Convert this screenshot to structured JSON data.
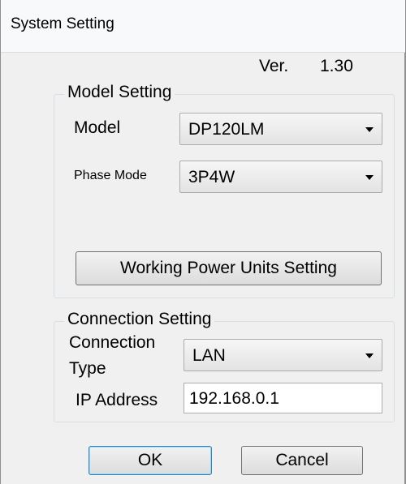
{
  "window": {
    "title": "System Setting"
  },
  "version": {
    "label": "Ver.",
    "value": "1.30"
  },
  "model_setting": {
    "group_title": "Model Setting",
    "model_label": "Model",
    "model_value": "DP120LM",
    "phase_mode_label": "Phase Mode",
    "phase_mode_value": "3P4W",
    "working_power_units_button": "Working Power Units Setting"
  },
  "connection_setting": {
    "group_title": "Connection Setting",
    "connection_type_label_line1": "Connection",
    "connection_type_label_line2": "Type",
    "connection_type_value": "LAN",
    "ip_address_label": "IP Address",
    "ip_address_value": "192.168.0.1"
  },
  "buttons": {
    "ok": "OK",
    "cancel": "Cancel"
  }
}
